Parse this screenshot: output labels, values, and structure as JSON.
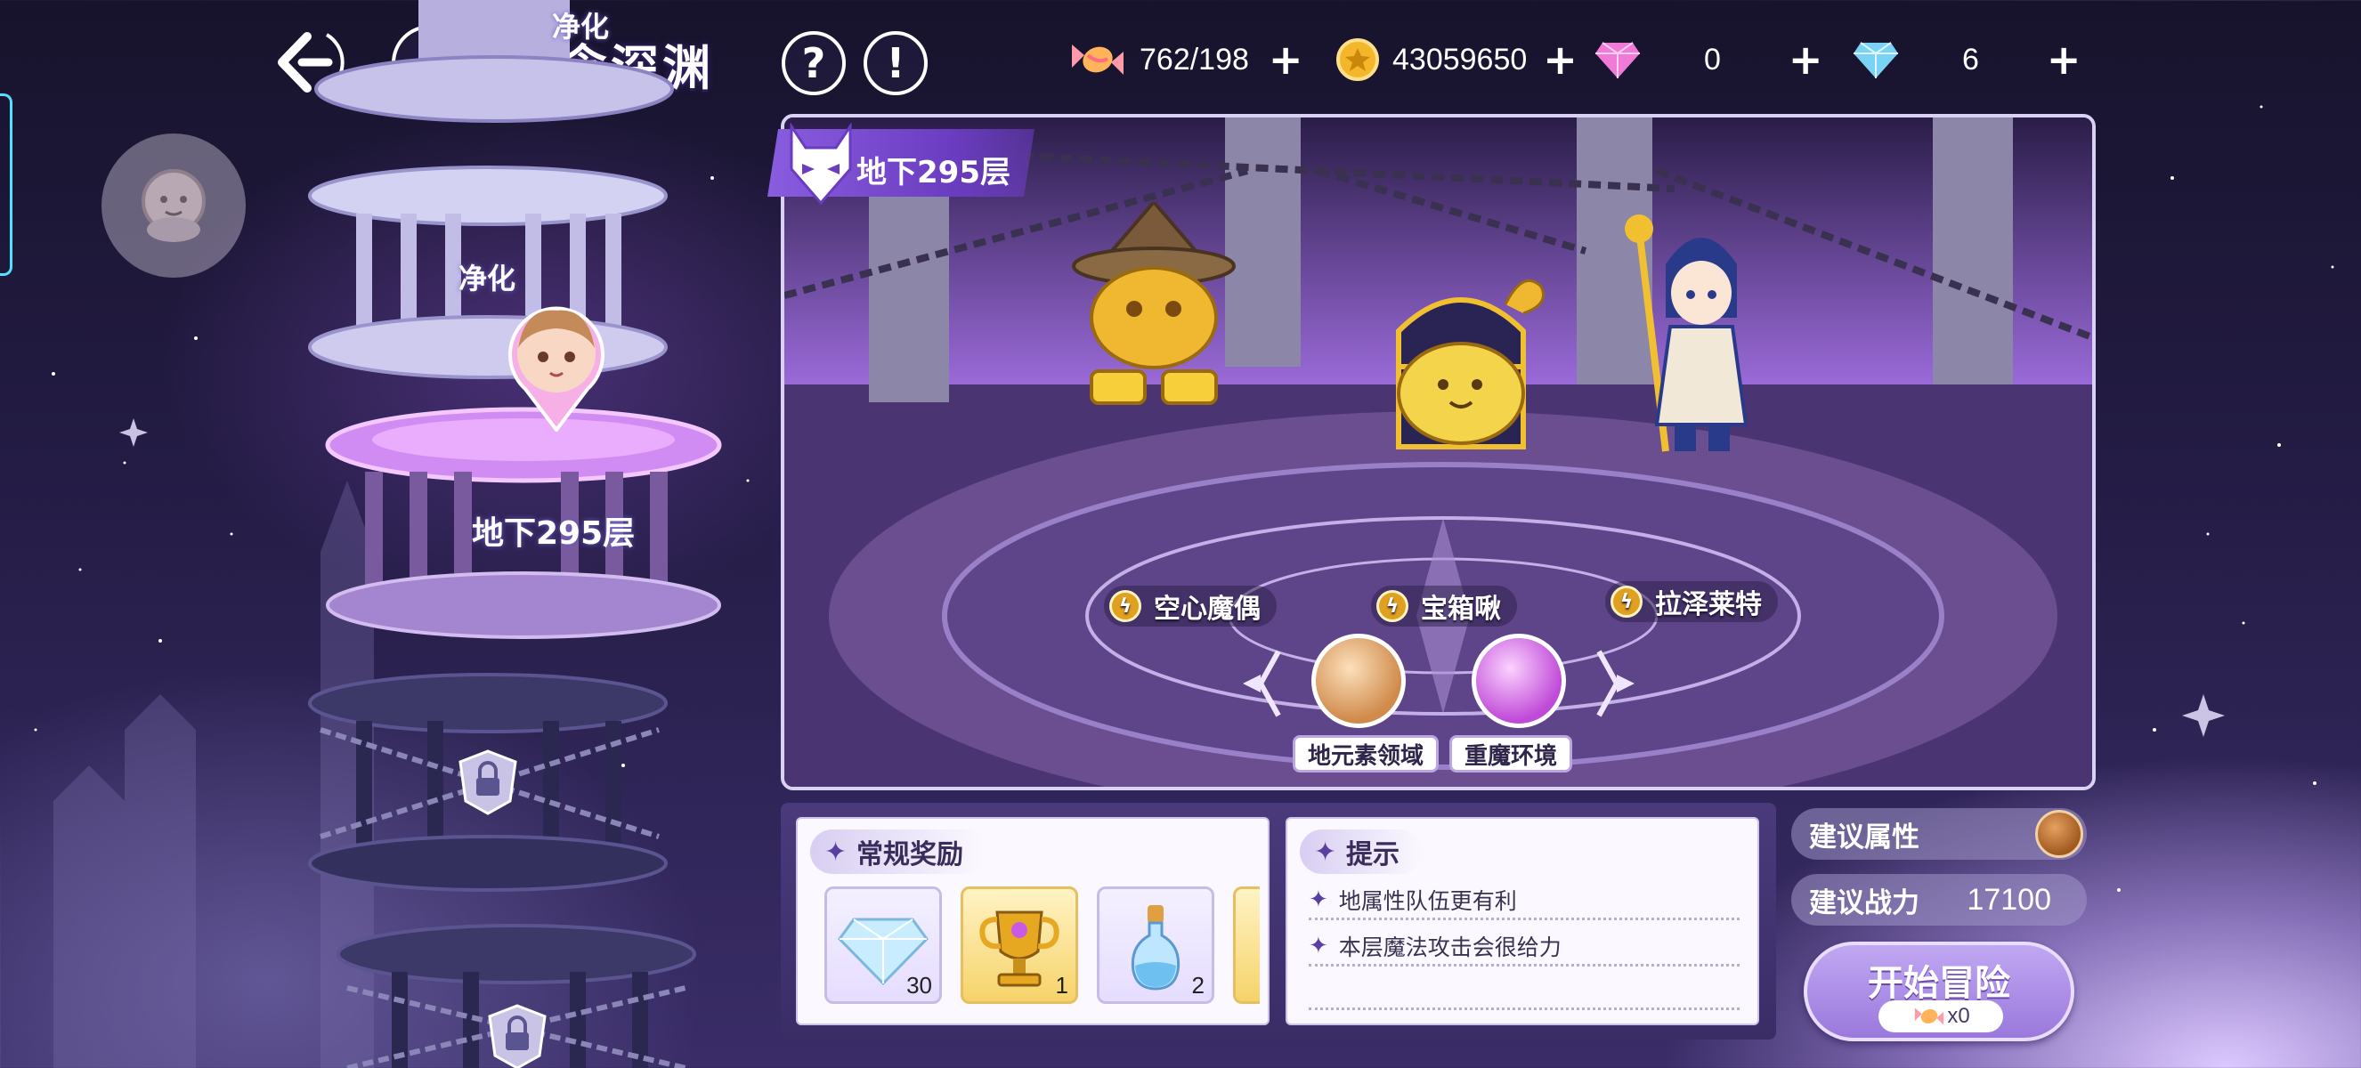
{
  "header": {
    "title": "恶念深渊",
    "back_icon": "back-arrow-icon",
    "castle_icon": "castle-icon",
    "help_label": "?",
    "notice_label": "!"
  },
  "currencies": {
    "candy": {
      "value": "762/198",
      "icon": "candy-icon",
      "plus": "+"
    },
    "gold": {
      "value": "43059650",
      "icon": "gold-coin-icon",
      "plus": "+"
    },
    "gem": {
      "value": "0",
      "icon": "pink-gem-icon",
      "plus": "+"
    },
    "diamond": {
      "value": "6",
      "icon": "blue-diamond-icon",
      "plus": "+"
    }
  },
  "tower": {
    "floors": [
      {
        "label": "净化",
        "state": "cleared"
      },
      {
        "label": "净化",
        "state": "cleared"
      },
      {
        "label": "地下295层",
        "state": "current"
      },
      {
        "label": "",
        "state": "locked"
      },
      {
        "label": "",
        "state": "locked"
      }
    ]
  },
  "scene": {
    "floor_tag": "地下295层",
    "enemies": [
      {
        "name": "空心魔偶",
        "element": "lightning"
      },
      {
        "name": "宝箱啾",
        "element": "lightning"
      },
      {
        "name": "拉泽莱特",
        "element": "lightning"
      }
    ],
    "field_effects": [
      {
        "label": "地元素领域"
      },
      {
        "label": "重魔环境"
      }
    ]
  },
  "rewards": {
    "title": "常规奖励",
    "items": [
      {
        "icon": "diamond-icon",
        "count": "30"
      },
      {
        "icon": "golden-trophy-icon",
        "count": "1"
      },
      {
        "icon": "potion-bottle-icon",
        "count": "2"
      }
    ]
  },
  "tips": {
    "title": "提示",
    "lines": [
      "地属性队伍更有利",
      "本层魔法攻击会很给力"
    ]
  },
  "recommend": {
    "attribute_label": "建议属性",
    "attribute_icon": "earth-element-icon",
    "power_label": "建议战力",
    "power_value": "17100"
  },
  "start": {
    "label": "开始冒险",
    "cost": "x0"
  },
  "colors": {
    "accent": "#8a5ce0",
    "panel_bg": "#3a2d66",
    "button": "#a582e2"
  }
}
